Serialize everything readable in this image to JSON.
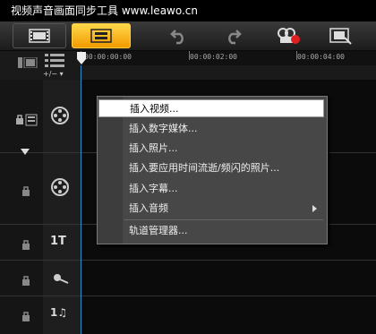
{
  "title_bar": {
    "text": "视频声音画面同步工具 www.leawo.cn"
  },
  "toolbar": {
    "film_view_icon": "film-strip-icon",
    "storyboard_icon": "storyboard-icon",
    "undo_icon": "undo-icon",
    "redo_icon": "redo-icon",
    "record_icon": "record-capture-icon",
    "render_icon": "smart-render-icon",
    "active_color": "#f5a800"
  },
  "timeline": {
    "ruler_labels": [
      "00:00:00:00",
      "00:00:02:00",
      "00:00:04:00"
    ],
    "zoom_control": "+/−",
    "playhead_color": "#2a8fd0"
  },
  "tracks": [
    {
      "icon": "video-reel-icon",
      "locked": false
    },
    {
      "icon": "overlay-reel-icon",
      "locked": false
    },
    {
      "icon": "title-icon",
      "label": "1T",
      "locked": false
    },
    {
      "icon": "voice-icon",
      "locked": false
    },
    {
      "icon": "music-icon",
      "label": "1♫",
      "locked": false
    }
  ],
  "context_menu": {
    "items": [
      {
        "label": "插入视频...",
        "selected": true,
        "submenu": false
      },
      {
        "label": "插入数字媒体...",
        "selected": false,
        "submenu": false
      },
      {
        "label": "插入照片...",
        "selected": false,
        "submenu": false
      },
      {
        "label": "插入要应用时间流逝/频闪的照片...",
        "selected": false,
        "submenu": false
      },
      {
        "label": "插入字幕...",
        "selected": false,
        "submenu": false
      },
      {
        "label": "插入音频",
        "selected": false,
        "submenu": true
      },
      {
        "label": "轨道管理器...",
        "selected": false,
        "submenu": false
      }
    ]
  }
}
